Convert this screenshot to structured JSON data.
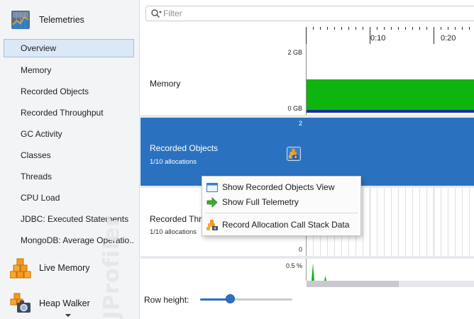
{
  "sidebar": {
    "telemetries_label": "Telemetries",
    "items": [
      {
        "label": "Overview",
        "selected": true
      },
      {
        "label": "Memory"
      },
      {
        "label": "Recorded Objects"
      },
      {
        "label": "Recorded Throughput"
      },
      {
        "label": "GC Activity"
      },
      {
        "label": "Classes"
      },
      {
        "label": "Threads"
      },
      {
        "label": "CPU Load"
      },
      {
        "label": "JDBC: Executed Statements"
      },
      {
        "label": "MongoDB: Average Operatio..."
      }
    ],
    "live_memory_label": "Live Memory",
    "heap_walker_label": "Heap Walker",
    "watermark": "JProfiler"
  },
  "filter": {
    "placeholder": "Filter",
    "value": ""
  },
  "timeline": {
    "labels": [
      "0:10",
      "0:20"
    ]
  },
  "rows": {
    "memory": {
      "title": "Memory",
      "max_label": "2 GB",
      "min_label": "0 GB"
    },
    "recorded_objects": {
      "title": "Recorded Objects",
      "subtitle": "1/10 allocations",
      "max_label": "2"
    },
    "recorded_throughput": {
      "title": "Recorded Throu",
      "subtitle": "1/10 allocations",
      "min_label": "0"
    },
    "gc_activity": {
      "max_label": "0.5 %"
    }
  },
  "context_menu": {
    "items": [
      {
        "label": "Show Recorded Objects View",
        "icon": "window-icon"
      },
      {
        "label": "Show Full Telemetry",
        "icon": "green-arrow-icon"
      },
      {
        "label": "Record Allocation Call Stack Data",
        "icon": "allocation-record-icon"
      }
    ]
  },
  "bottom": {
    "row_height_label": "Row height:",
    "row_height_level": 0.33
  },
  "colors": {
    "accent": "#2a72c0",
    "memory_fill": "#0fb50f",
    "selection": "#dbe8f5"
  }
}
